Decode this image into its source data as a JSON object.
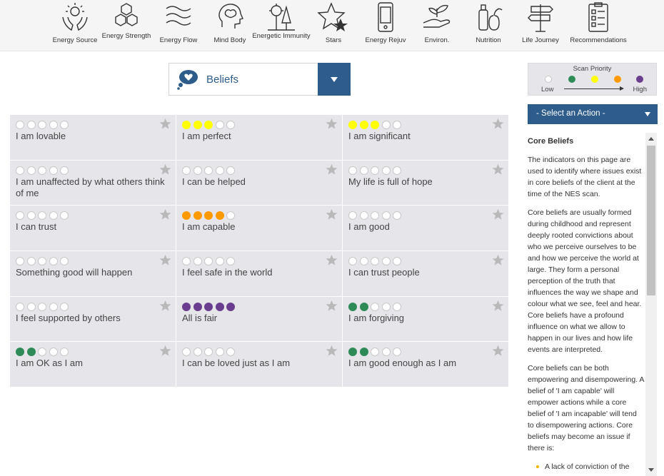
{
  "nav": [
    {
      "label": "Energy Source",
      "icon": "hands-energy-icon"
    },
    {
      "label": "Energy Strength",
      "icon": "hexagons-icon"
    },
    {
      "label": "Energy Flow",
      "icon": "waves-icon"
    },
    {
      "label": "Mind Body",
      "icon": "brain-head-icon"
    },
    {
      "label": "Energetic Immunity",
      "icon": "virus-tree-icon"
    },
    {
      "label": "Stars",
      "icon": "stars-icon"
    },
    {
      "label": "Energy Rejuv",
      "icon": "device-icon"
    },
    {
      "label": "Environ.",
      "icon": "hand-plant-icon"
    },
    {
      "label": "Nutrition",
      "icon": "fruit-bottle-icon"
    },
    {
      "label": "Life Journey",
      "icon": "signpost-icon"
    },
    {
      "label": "Recommendations",
      "icon": "clipboard-icon"
    }
  ],
  "category": {
    "label": "Beliefs",
    "icon": "thought-heart-icon"
  },
  "colors": {
    "accent": "#2e5d8c",
    "low": "#ffffff",
    "green": "#2e8b57",
    "yellow": "#ffff00",
    "orange": "#ff9900",
    "purple": "#6a3d8f",
    "star": "#b9b9b9"
  },
  "legend": {
    "title": "Scan Priority",
    "low": "Low",
    "high": "High"
  },
  "action": {
    "label": "- Select an Action -"
  },
  "beliefs": [
    {
      "text": "I am lovable",
      "level": 0,
      "color": "none"
    },
    {
      "text": "I am perfect",
      "level": 3,
      "color": "yellow"
    },
    {
      "text": "I am significant",
      "level": 3,
      "color": "yellow"
    },
    {
      "text": "I am unaffected by what others think of me",
      "level": 0,
      "color": "none"
    },
    {
      "text": "I can be helped",
      "level": 0,
      "color": "none"
    },
    {
      "text": "My life is full of hope",
      "level": 0,
      "color": "none"
    },
    {
      "text": "I can trust",
      "level": 0,
      "color": "none"
    },
    {
      "text": "I am capable",
      "level": 4,
      "color": "orange"
    },
    {
      "text": "I am good",
      "level": 0,
      "color": "none"
    },
    {
      "text": "Something good will happen",
      "level": 0,
      "color": "none"
    },
    {
      "text": "I feel safe in the world",
      "level": 0,
      "color": "none"
    },
    {
      "text": "I can trust people",
      "level": 0,
      "color": "none"
    },
    {
      "text": "I feel supported by others",
      "level": 0,
      "color": "none"
    },
    {
      "text": "All is fair",
      "level": 5,
      "color": "purple"
    },
    {
      "text": "I am forgiving",
      "level": 2,
      "color": "green"
    },
    {
      "text": "I am OK as I am",
      "level": 2,
      "color": "green"
    },
    {
      "text": "I can be loved just as I am",
      "level": 0,
      "color": "none"
    },
    {
      "text": "I am good enough as I am",
      "level": 2,
      "color": "green"
    }
  ],
  "info": {
    "title": "Core Beliefs",
    "p1": "The indicators on this page are used to identify where issues exist in core beliefs of the client at the time of the NES scan.",
    "p2": "Core beliefs are usually formed during childhood and represent deeply rooted convictions about who we perceive ourselves to be and how we perceive the world at large. They form a personal perception of the truth that influences the way we shape and colour what we see, feel and hear. Core beliefs have a profound influence on what we allow to happen in our lives and how life events are interpreted.",
    "p3": "Core beliefs can be both empowering and disempowering. A belief of 'I am capable' will empower actions while a core belief of 'I am incapable' will tend to disempowering actions. Core beliefs may become an issue if there is:",
    "bullet1": "A lack of conviction of the"
  }
}
